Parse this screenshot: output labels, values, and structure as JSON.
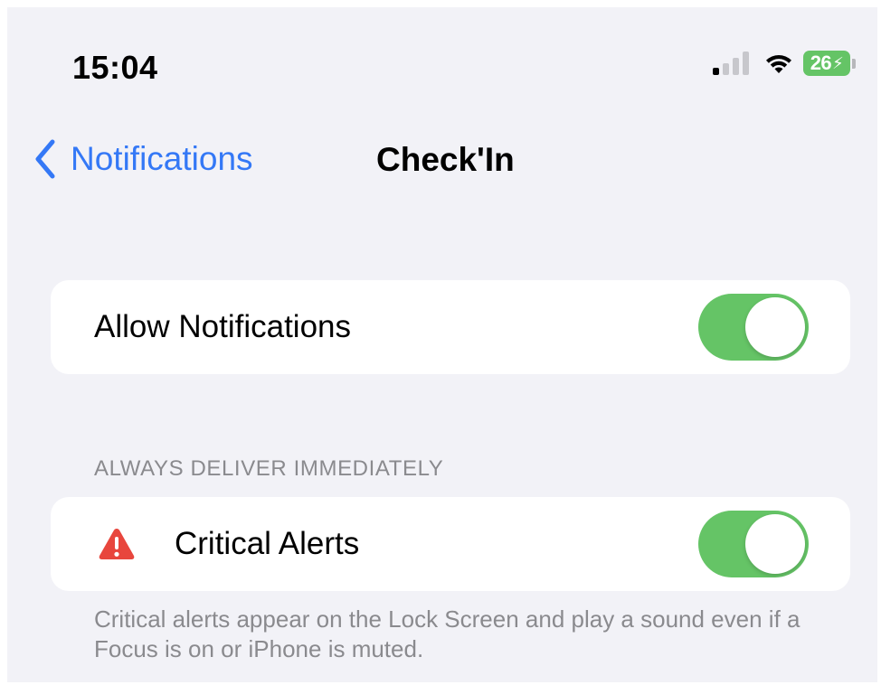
{
  "status_bar": {
    "time": "15:04",
    "battery_percent": "26",
    "battery_charging_glyph": "⚡",
    "signal_bars_active": 1,
    "signal_bars_total": 4
  },
  "nav": {
    "back_label": "Notifications",
    "title": "Check'In"
  },
  "allow_notifications": {
    "label": "Allow Notifications",
    "enabled": true
  },
  "always_deliver_section": {
    "header": "ALWAYS DELIVER IMMEDIATELY",
    "critical_alerts": {
      "label": "Critical Alerts",
      "icon": "warning-triangle-icon",
      "enabled": true
    },
    "footer": "Critical alerts appear on the Lock Screen and play a sound even if a Focus is on or iPhone is muted."
  },
  "colors": {
    "accent_blue": "#3478f6",
    "toggle_on_green": "#65c466",
    "alert_red": "#e8463d",
    "background": "#f2f2f7",
    "secondary_text": "#8a8a8e"
  }
}
